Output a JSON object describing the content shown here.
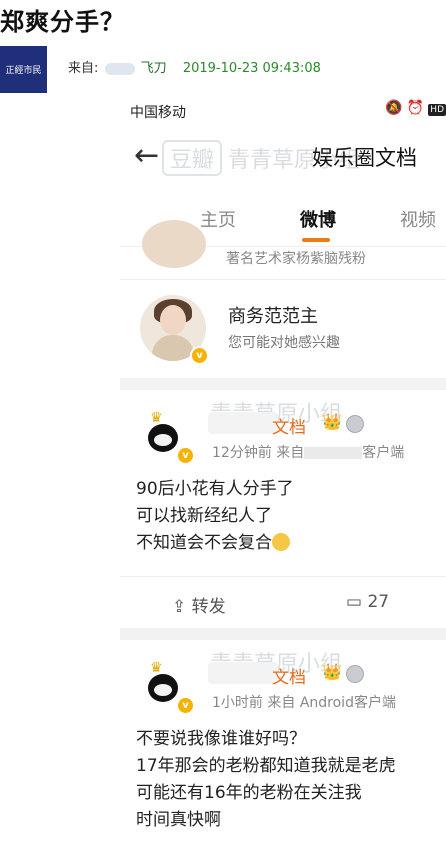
{
  "post": {
    "title": "郑爽分手？",
    "avatar_text": "正經市民",
    "from_label": "来自:",
    "author": "飞刀",
    "date": "2019-10-23 09:43:08"
  },
  "phone": {
    "status": {
      "carrier": "中国移动",
      "mute_icon": "mute-icon",
      "alarm_icon": "alarm-icon",
      "hd_label": "HD"
    },
    "nav": {
      "back_icon": "back-arrow-icon",
      "title": "娱乐圈文档"
    },
    "watermark": {
      "box_text": "豆瓣",
      "text": "青青草原小组"
    },
    "tabs": [
      {
        "label": "主页",
        "active": false
      },
      {
        "label": "微博",
        "active": true
      },
      {
        "label": "视频",
        "active": false
      }
    ],
    "prev_item_text": "著名艺术家杨紫脑残粉",
    "recommend": {
      "name": "商务范范主",
      "subtitle": "您可能对她感兴趣"
    },
    "posts": [
      {
        "name_suffix": "文档",
        "time": "12分钟前",
        "source_prefix": "来自",
        "source_suffix": "客户端",
        "lines": [
          "90后小花有人分手了",
          "可以找新经纪人了",
          "不知道会不会复合"
        ],
        "repost_label": "转发",
        "comment_count": "27"
      },
      {
        "name_suffix": "文档",
        "time": "1小时前",
        "source": "来自 Android客户端",
        "lines": [
          "不要说我像谁谁好吗？",
          "17年那会的老粉都知道我就是老虎",
          "可能还有16年的老粉在关注我",
          "时间真快啊"
        ]
      }
    ],
    "accent_color": "#f07a16"
  }
}
